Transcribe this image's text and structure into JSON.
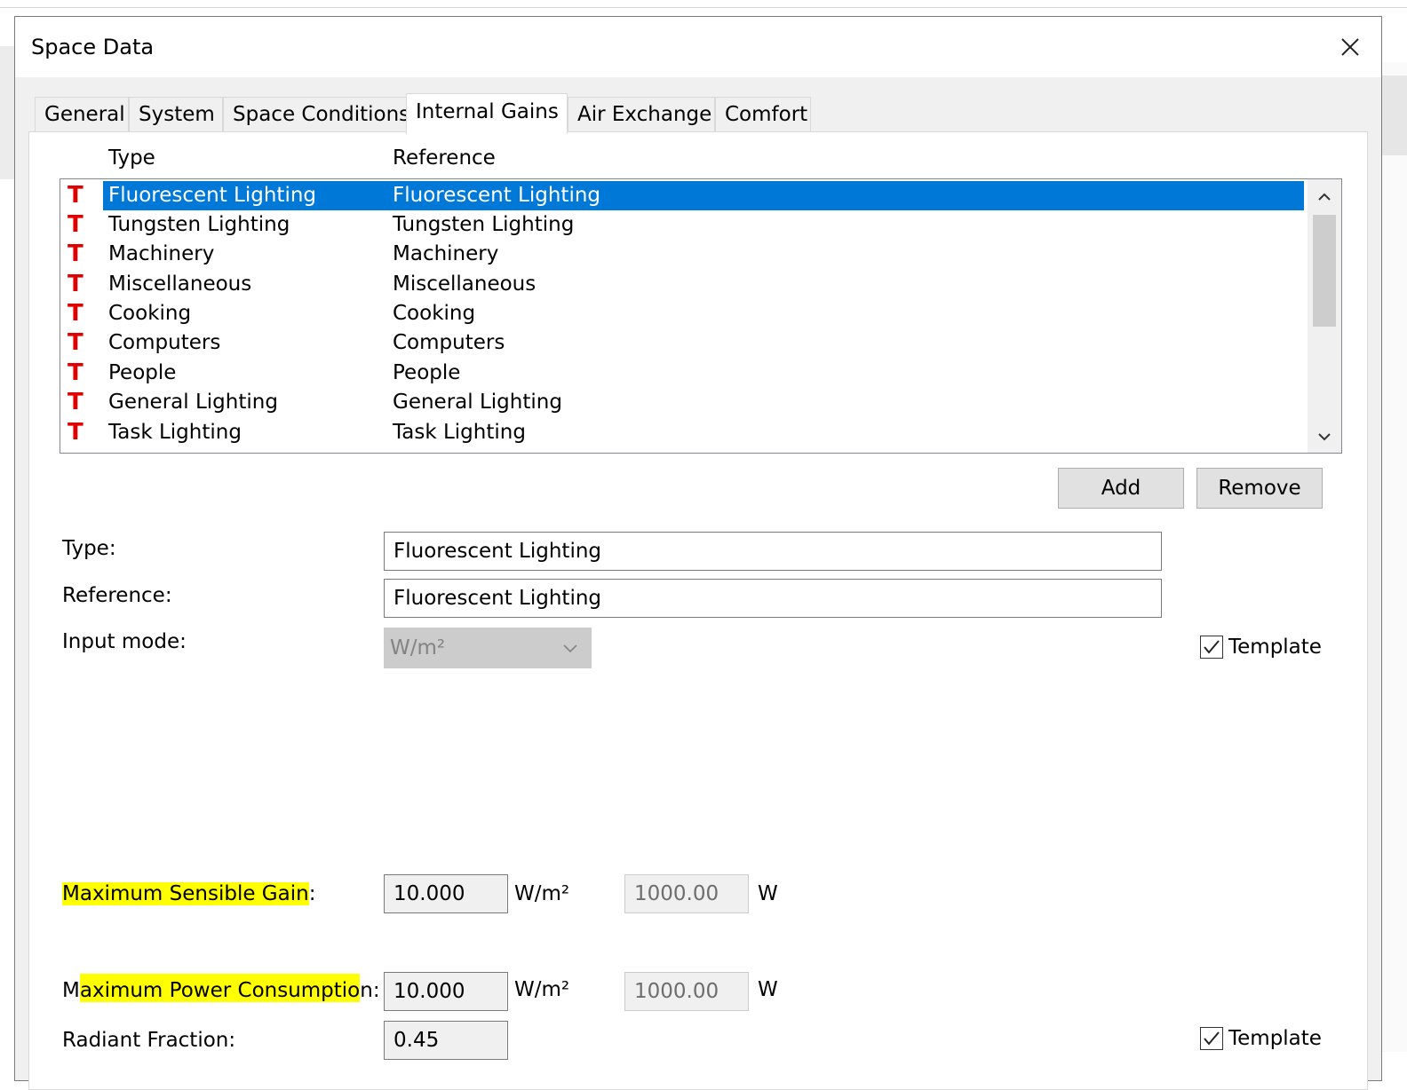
{
  "dialog": {
    "title": "Space Data"
  },
  "tabs": [
    {
      "label": "General"
    },
    {
      "label": "System"
    },
    {
      "label": "Space Conditions"
    },
    {
      "label": "Internal Gains"
    },
    {
      "label": "Air Exchange"
    },
    {
      "label": "Comfort"
    }
  ],
  "active_tab": "Internal Gains",
  "list": {
    "columns": {
      "type": "Type",
      "reference": "Reference"
    },
    "rows": [
      {
        "icon": "T",
        "type": "Fluorescent Lighting",
        "reference": "Fluorescent Lighting",
        "selected": true
      },
      {
        "icon": "T",
        "type": "Tungsten Lighting",
        "reference": "Tungsten Lighting"
      },
      {
        "icon": "T",
        "type": "Machinery",
        "reference": "Machinery"
      },
      {
        "icon": "T",
        "type": "Miscellaneous",
        "reference": "Miscellaneous"
      },
      {
        "icon": "T",
        "type": "Cooking",
        "reference": "Cooking"
      },
      {
        "icon": "T",
        "type": "Computers",
        "reference": "Computers"
      },
      {
        "icon": "T",
        "type": "People",
        "reference": "People"
      },
      {
        "icon": "T",
        "type": "General Lighting",
        "reference": "General Lighting"
      },
      {
        "icon": "T",
        "type": "Task Lighting",
        "reference": "Task Lighting"
      }
    ]
  },
  "buttons": {
    "add": "Add",
    "remove": "Remove"
  },
  "form": {
    "type_label": "Type:",
    "type_value": "Fluorescent Lighting",
    "reference_label": "Reference:",
    "reference_value": "Fluorescent Lighting",
    "input_mode_label": "Input mode:",
    "input_mode_value": "W/m²",
    "template_label": "Template",
    "template_checked": true,
    "max_sensible_label": "Maximum Sensible Gain",
    "max_sensible_colon": ":",
    "max_sensible_value": "10.000",
    "max_sensible_unit": "W/m²",
    "max_sensible_total": "1000.00",
    "max_sensible_total_unit": "W",
    "max_power_label_prefix": "M",
    "max_power_label_highlight": "aximum Power Consumptio",
    "max_power_label_suffix": "n:",
    "max_power_value": "10.000",
    "max_power_unit": "W/m²",
    "max_power_total": "1000.00",
    "max_power_total_unit": "W",
    "radiant_label": "Radiant Fraction:",
    "radiant_value": "0.45",
    "template2_label": "Template"
  },
  "colors": {
    "selection": "#0078d7",
    "template_icon": "#e00000",
    "highlight": "#ffff00"
  }
}
